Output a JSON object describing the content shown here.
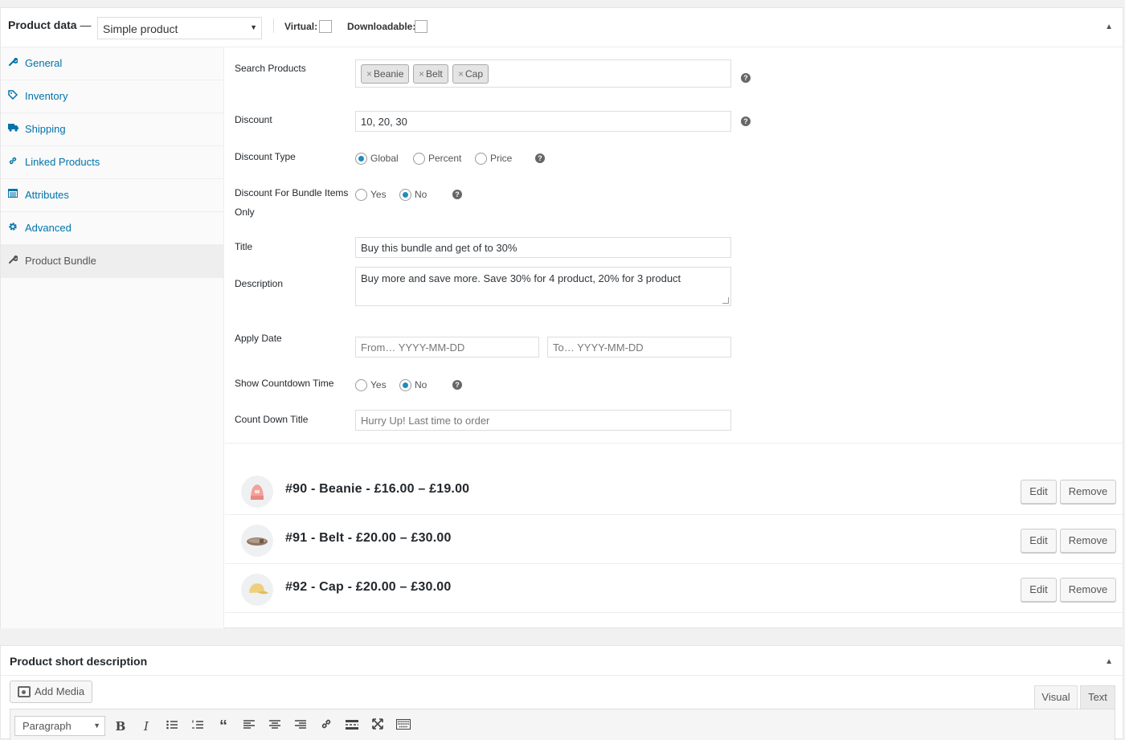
{
  "product_data": {
    "title": "Product data",
    "dash": "—",
    "product_type": "Simple product",
    "virtual_label": "Virtual:",
    "downloadable_label": "Downloadable:"
  },
  "tabs": [
    {
      "label": "General",
      "icon": "wrench-icon"
    },
    {
      "label": "Inventory",
      "icon": "tag-icon"
    },
    {
      "label": "Shipping",
      "icon": "truck-icon"
    },
    {
      "label": "Linked Products",
      "icon": "link-icon"
    },
    {
      "label": "Attributes",
      "icon": "table-icon"
    },
    {
      "label": "Advanced",
      "icon": "gear-icon"
    },
    {
      "label": "Product Bundle",
      "icon": "wrench-icon"
    }
  ],
  "form": {
    "search_products": {
      "label": "Search Products",
      "tags": [
        "Beanie",
        "Belt",
        "Cap"
      ]
    },
    "discount": {
      "label": "Discount",
      "value": "10, 20, 30"
    },
    "discount_type": {
      "label": "Discount Type",
      "options": [
        "Global",
        "Percent",
        "Price"
      ],
      "selected": "Global"
    },
    "bundle_only": {
      "label_line1": "Discount For Bundle Items",
      "label_line2": "Only",
      "options": [
        "Yes",
        "No"
      ],
      "selected": "No"
    },
    "title": {
      "label": "Title",
      "value": "Buy this bundle and get of to 30%"
    },
    "description": {
      "label": "Description",
      "value": "Buy more and save more. Save 30% for 4 product, 20% for 3 product"
    },
    "apply_date": {
      "label": "Apply Date",
      "from_placeholder": "From… YYYY-MM-DD",
      "to_placeholder": "To…  YYYY-MM-DD"
    },
    "countdown": {
      "label": "Show Countdown Time",
      "options": [
        "Yes",
        "No"
      ],
      "selected": "No"
    },
    "countdown_title": {
      "label": "Count Down Title",
      "placeholder": "Hurry Up! Last time to order"
    },
    "help_glyph": "?"
  },
  "bundle_items": [
    {
      "text": "#90 - Beanie - £16.00 – £19.00",
      "product": "Beanie"
    },
    {
      "text": "#91 - Belt - £20.00 – £30.00",
      "product": "Belt"
    },
    {
      "text": "#92 - Cap - £20.00 – £30.00",
      "product": "Cap"
    }
  ],
  "buttons": {
    "edit": "Edit",
    "remove": "Remove"
  },
  "short_description": {
    "title": "Product short description",
    "add_media": "Add Media",
    "visual_tab": "Visual",
    "text_tab": "Text",
    "format": "Paragraph"
  },
  "colors": {
    "link": "#0073aa",
    "radio_on": "#1e8cbe"
  }
}
